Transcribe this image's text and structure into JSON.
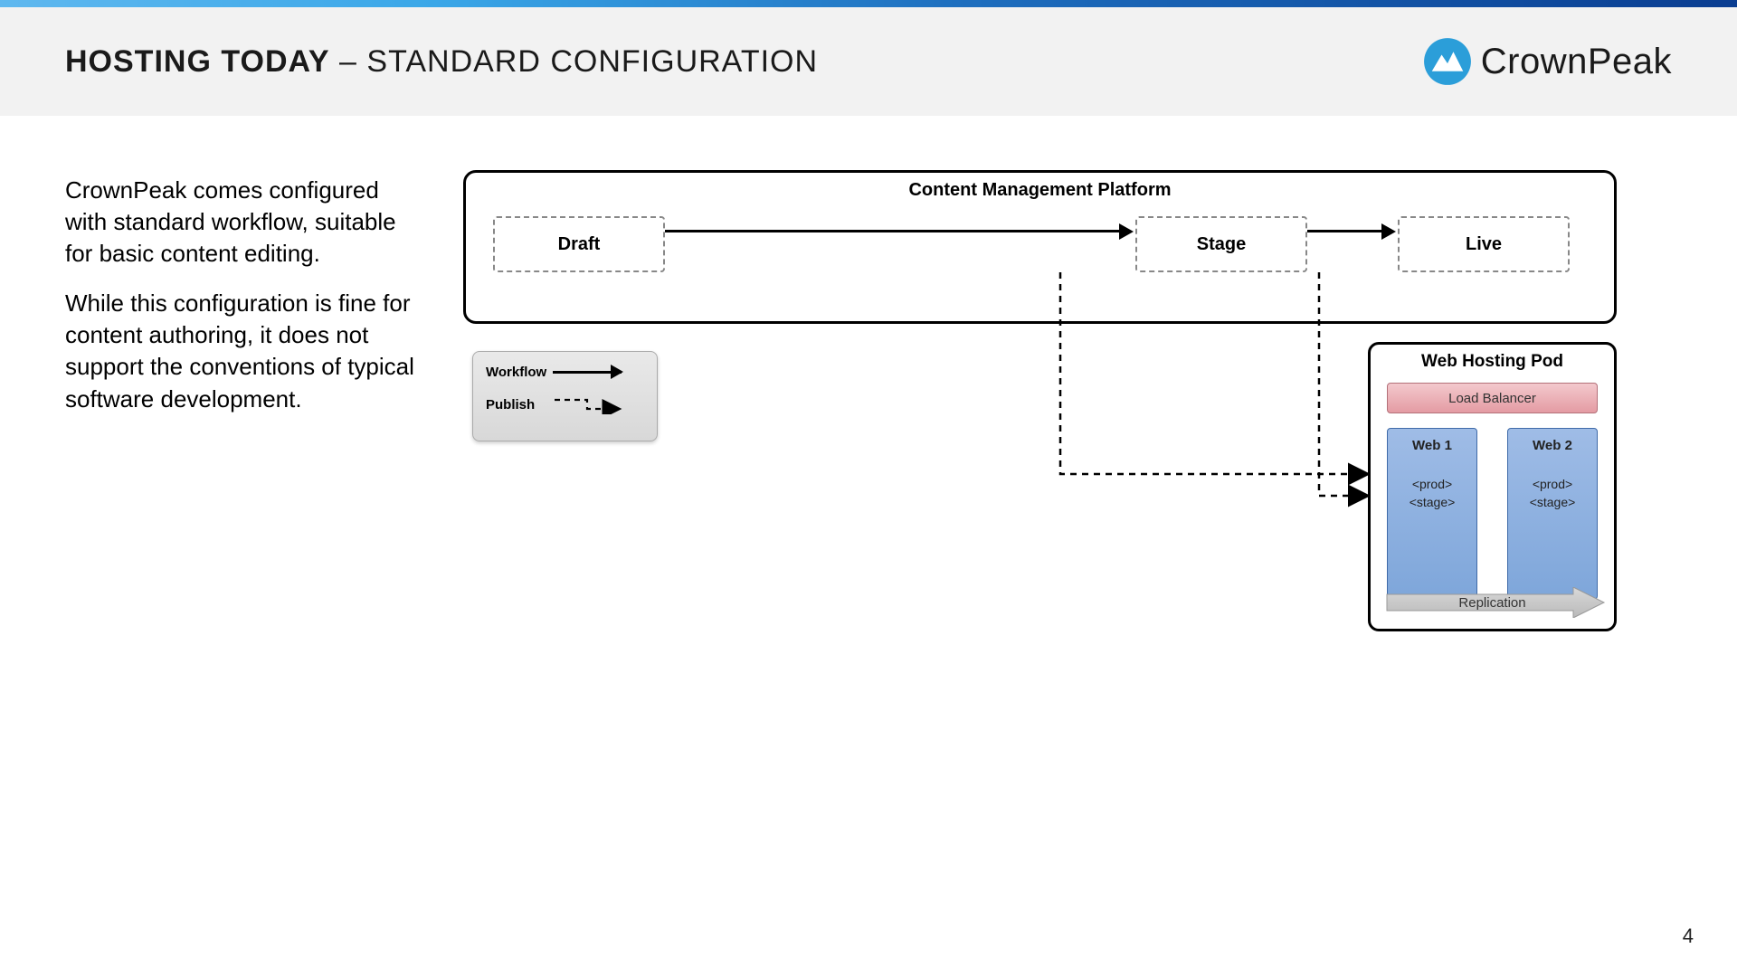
{
  "header": {
    "title_bold": "HOSTING TODAY",
    "title_sub": " – STANDARD CONFIGURATION",
    "brand": "CrownPeak"
  },
  "body": {
    "para1": "CrownPeak comes configured with standard workflow, suitable for basic content editing.",
    "para2": "While this configuration is fine for content authoring, it does not support the conventions of typical software development."
  },
  "diagram": {
    "platform_title": "Content Management Platform",
    "draft": "Draft",
    "stage": "Stage",
    "live": "Live",
    "legend": {
      "workflow": "Workflow",
      "publish": "Publish"
    },
    "pod": {
      "title": "Web Hosting Pod",
      "load_balancer": "Load Balancer",
      "web1": "Web 1",
      "web2": "Web 2",
      "prod": "<prod>",
      "stage": "<stage>",
      "replication": "Replication"
    }
  },
  "page_number": "4"
}
